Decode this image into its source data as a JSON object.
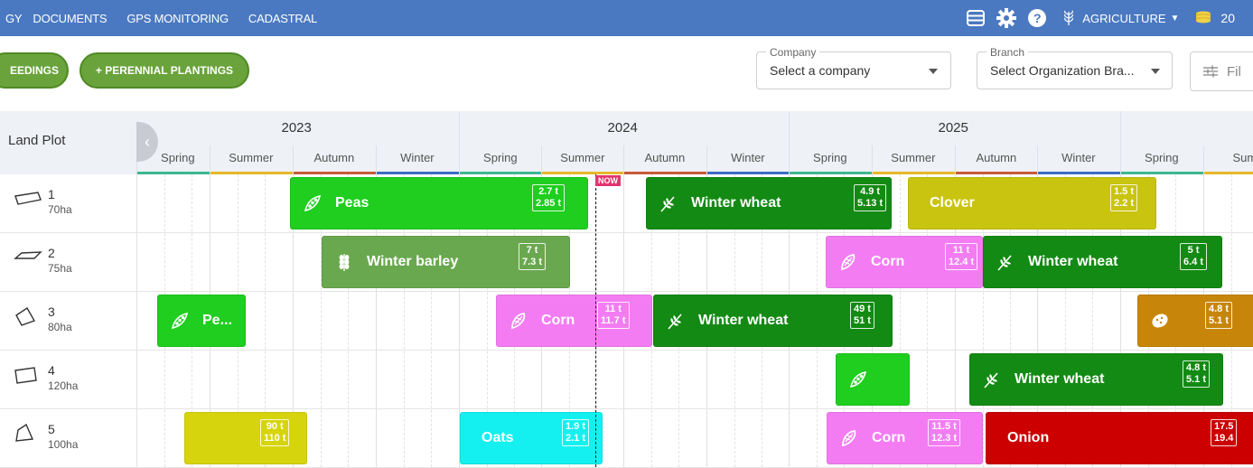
{
  "topbar": {
    "nav": [
      "GY",
      "DOCUMENTS",
      "GPS MONITORING",
      "CADASTRAL"
    ],
    "icons": [
      "stack-icon",
      "gear-icon",
      "help-icon"
    ],
    "help_glyph": "?",
    "crop_label": "AGRICULTURE",
    "coins_value": "20",
    "bg_color": "#4a79c1"
  },
  "toolbar": {
    "seedings_label": "EEDINGS",
    "perennial_label": "+ PERENNIAL PLANTINGS",
    "company": {
      "label": "Company",
      "value": "Select a company"
    },
    "branch": {
      "label": "Branch",
      "value": "Select Organization Bra..."
    },
    "filter_label": "Fil"
  },
  "timeline": {
    "header_label": "Land Plot",
    "years": [
      "2023",
      "2024",
      "2025"
    ],
    "seasons": [
      "Spring",
      "Summer",
      "Autumn",
      "Winter",
      "Spring",
      "Summer",
      "Autumn",
      "Winter",
      "Spring",
      "Summer",
      "Autumn",
      "Winter",
      "Spring",
      "Sum"
    ],
    "season_colors": {
      "Spring": "#3cb88f",
      "Summer": "#e8b729",
      "Autumn": "#c75a3a",
      "Winter": "#3d6cc4"
    },
    "now_label": "NOW"
  },
  "plots": [
    {
      "num": "1",
      "area": "70ha"
    },
    {
      "num": "2",
      "area": "75ha"
    },
    {
      "num": "3",
      "area": "80ha"
    },
    {
      "num": "4",
      "area": "120ha"
    },
    {
      "num": "5",
      "area": "100ha"
    }
  ],
  "crops": [
    {
      "row": 0,
      "name": "Peas",
      "icon": "peas-icon",
      "yield1": "2.7 t",
      "yield2": "2.85 t",
      "color": "#1fce1f"
    },
    {
      "row": 0,
      "name": "Winter wheat",
      "icon": "wheat-icon",
      "yield1": "4.9 t",
      "yield2": "5.13 t",
      "color": "#138a13"
    },
    {
      "row": 0,
      "name": "Clover",
      "icon": "",
      "yield1": "1.5 t",
      "yield2": "2.2 t",
      "color": "#c9c40f"
    },
    {
      "row": 1,
      "name": "Winter barley",
      "icon": "barley-icon",
      "yield1": "7 t",
      "yield2": "7.3 t",
      "color": "#6aa84f"
    },
    {
      "row": 1,
      "name": "Corn",
      "icon": "corn-icon",
      "yield1": "11 t",
      "yield2": "12.4 t",
      "color": "#f37cf3"
    },
    {
      "row": 1,
      "name": "Winter wheat",
      "icon": "wheat-icon",
      "yield1": "5 t",
      "yield2": "6.4 t",
      "color": "#138a13"
    },
    {
      "row": 2,
      "name": "Pe...",
      "icon": "peas-icon",
      "yield1": "",
      "yield2": "",
      "color": "#1fce1f"
    },
    {
      "row": 2,
      "name": "Corn",
      "icon": "corn-icon",
      "yield1": "11 t",
      "yield2": "11.7 t",
      "color": "#f37cf3"
    },
    {
      "row": 2,
      "name": "Winter wheat",
      "icon": "wheat-icon",
      "yield1": "49 t",
      "yield2": "51 t",
      "color": "#138a13"
    },
    {
      "row": 2,
      "name": "",
      "icon": "potato-icon",
      "yield1": "4.8 t",
      "yield2": "5.1 t",
      "color": "#c7860a"
    },
    {
      "row": 3,
      "name": "",
      "icon": "peas-icon",
      "yield1": "",
      "yield2": "",
      "color": "#1fce1f"
    },
    {
      "row": 3,
      "name": "Winter wheat",
      "icon": "wheat-icon",
      "yield1": "4.8 t",
      "yield2": "5.1 t",
      "color": "#138a13"
    },
    {
      "row": 4,
      "name": "",
      "icon": "",
      "yield1": "90 t",
      "yield2": "110 t",
      "color": "#d6d40c"
    },
    {
      "row": 4,
      "name": "Oats",
      "icon": "",
      "yield1": "1.9 t",
      "yield2": "2.1 t",
      "color": "#14f0f0"
    },
    {
      "row": 4,
      "name": "Corn",
      "icon": "corn-icon",
      "yield1": "11.5 t",
      "yield2": "12.3 t",
      "color": "#f37cf3"
    },
    {
      "row": 4,
      "name": "Onion",
      "icon": "",
      "yield1": "17.5",
      "yield2": "19.4",
      "color": "#cc0000"
    }
  ]
}
